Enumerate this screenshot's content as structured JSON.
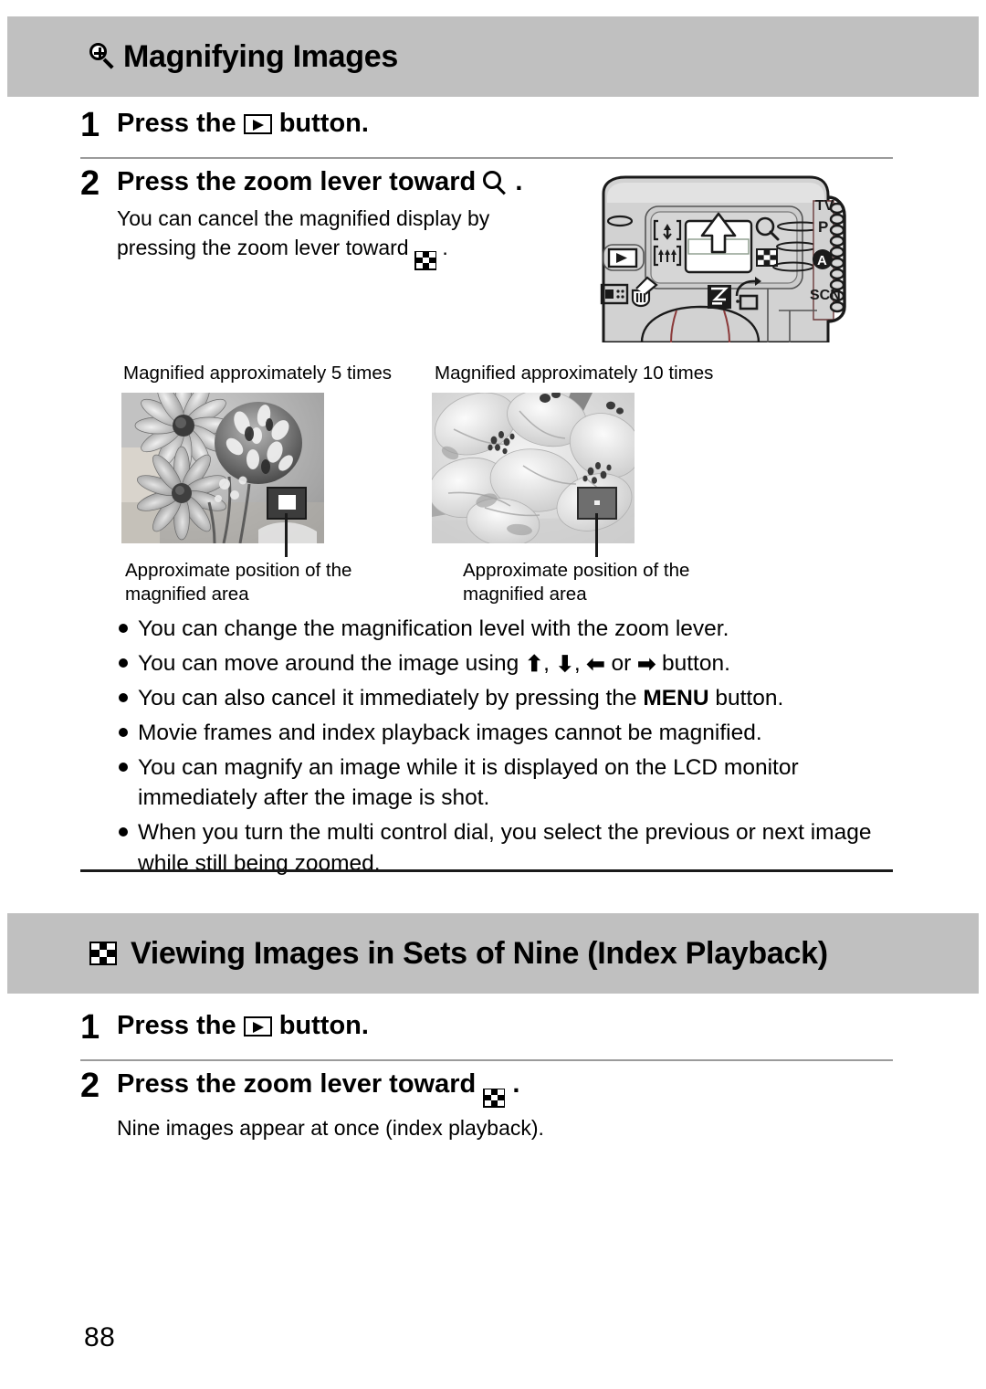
{
  "page": {
    "number": "88"
  },
  "sections": [
    {
      "id": "magnifying",
      "icon": "magnifier-plus-icon",
      "title": "Magnifying Images",
      "steps": [
        {
          "number": "1",
          "title_before": "Press the",
          "icon": "playback-button-icon",
          "title_after": "button.",
          "desc": ""
        },
        {
          "number": "2",
          "title_before": "Press the zoom lever toward",
          "icon": "magnifier-icon",
          "title_after": ".",
          "desc_line1": "You can cancel the magnified display by",
          "desc_line2_before": "pressing the zoom lever toward",
          "desc_icon": "index-checkerboard-icon",
          "desc_line2_after": "."
        }
      ],
      "figures": [
        {
          "caption": "Magnified approximately 5 times",
          "subcaption": "Approximate position of the magnified area",
          "alt": "grayscale photo of daisies magnified 5x"
        },
        {
          "caption": "Magnified approximately 10 times",
          "subcaption": "Approximate position of the magnified area",
          "alt": "grayscale photo of flower petals magnified 10x"
        }
      ],
      "notes": [
        {
          "text": "You can change the magnification level with the zoom lever."
        },
        {
          "text_before": "You can move around the image using",
          "arrows": [
            "⬆",
            "⬇",
            "⬅",
            "➡"
          ],
          "separators": [
            ",",
            ",",
            "or"
          ],
          "text_after": "button."
        },
        {
          "text_before": "You can also cancel it immediately by pressing the",
          "bold": "MENU",
          "text_after": "button."
        },
        {
          "text": "Movie frames and index playback images cannot be magnified."
        },
        {
          "text": "You can magnify an image while it is displayed on the LCD monitor immediately after the image is shot."
        },
        {
          "text": "When you turn the multi control dial, you select the previous or next image while still being zoomed."
        }
      ]
    },
    {
      "id": "index-playback",
      "icon": "index-checkerboard-icon",
      "title": "Viewing Images in Sets of Nine (Index Playback)",
      "steps": [
        {
          "number": "1",
          "title_before": "Press the",
          "icon": "playback-button-icon",
          "title_after": "button.",
          "desc": ""
        },
        {
          "number": "2",
          "title_before": "Press the zoom lever toward",
          "icon": "index-checkerboard-icon",
          "title_after": ".",
          "desc": "Nine images appear at once (index playback)."
        }
      ]
    }
  ],
  "camera_diagram": {
    "labels": {
      "mode_tv": "TV",
      "mode_p": "P",
      "mode_a": "A",
      "mode_scn": "SCN"
    },
    "controls": [
      "tele-zoom-icon",
      "wide-zoom-icon",
      "zoom-lever",
      "magnifier-icon",
      "index-checkerboard-icon",
      "playback-button-icon",
      "display-button-icon",
      "trash-icon",
      "exposure-compensation-icon",
      "rotate-icon"
    ]
  },
  "colors": {
    "header_band": "#c0c0c0",
    "rule_thin": "#9b9b9b",
    "rule_thick": "#1a1a1a"
  }
}
